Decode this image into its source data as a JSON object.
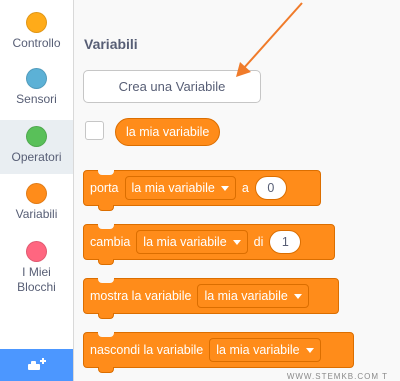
{
  "sidebar": {
    "items": [
      {
        "label": "Controllo",
        "color": "#ffab19",
        "selected": false
      },
      {
        "label": "Sensori",
        "color": "#5cb1d6",
        "selected": false
      },
      {
        "label": "Operatori",
        "color": "#59c059",
        "selected": true
      },
      {
        "label": "Variabili",
        "color": "#ff8c1a",
        "selected": false
      },
      {
        "label": "I Miei Blocchi",
        "color": "#ff6680",
        "selected": false
      }
    ],
    "extension_icon": "add-extension-icon"
  },
  "palette": {
    "section_title": "Variabili",
    "make_variable_label": "Crea una Variabile",
    "reporter_label": "la mia variabile",
    "blocks": {
      "set": {
        "text": "porta",
        "dropdown": "la mia variabile",
        "connector": "a",
        "value": "0"
      },
      "change": {
        "text": "cambia",
        "dropdown": "la mia variabile",
        "connector": "di",
        "value": "1"
      },
      "show": {
        "text": "mostra la variabile",
        "dropdown": "la mia variabile"
      },
      "hide": {
        "text": "nascondi la variabile",
        "dropdown": "la mia variabile"
      }
    }
  },
  "annotation": {
    "arrow_color": "#f07b2a"
  },
  "watermark": "WWW.STEMKB.COM T"
}
